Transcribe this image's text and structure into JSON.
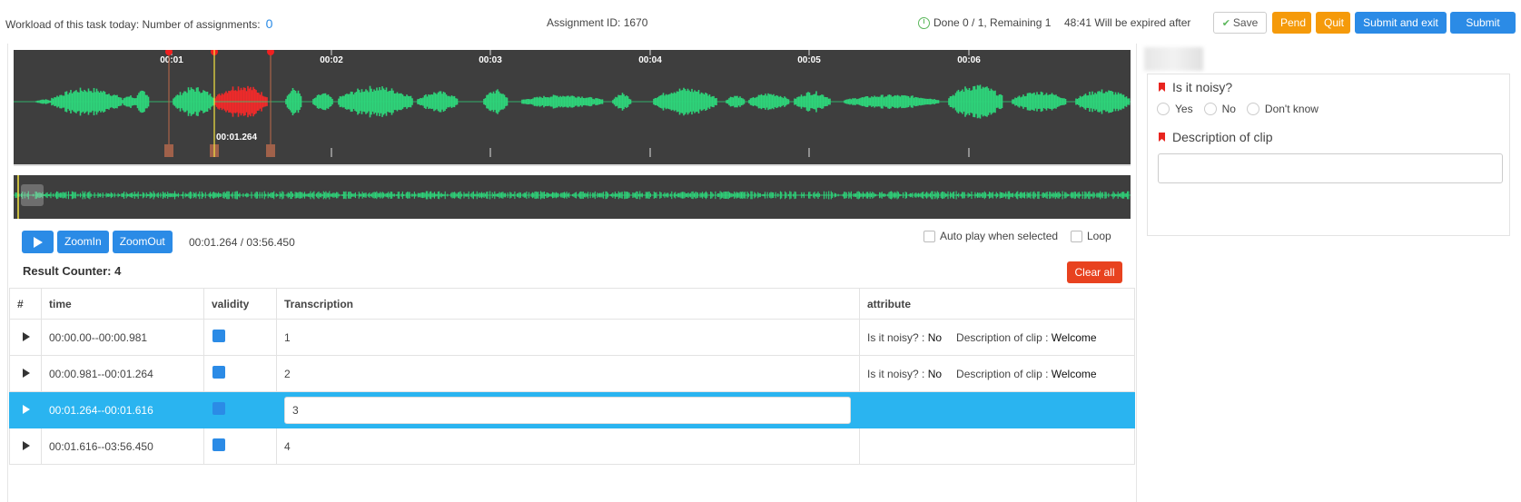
{
  "header": {
    "workload_label": "Workload of this task today: Number of assignments:",
    "workload_count": "0",
    "assignment_id": "Assignment ID: 1670",
    "done_text": "Done 0 / 1, Remaining 1",
    "expire_text": "48:41 Will be expired after",
    "buttons": {
      "save": "Save",
      "pend": "Pend",
      "quit": "Quit",
      "submit_exit": "Submit and exit",
      "submit": "Submit (D)"
    },
    "colors": {
      "primary": "#2b8be6",
      "warning": "#f59a0a",
      "danger": "#e8421f"
    }
  },
  "waveform": {
    "ticks": [
      "00:01",
      "00:02",
      "00:03",
      "00:04",
      "00:05",
      "00:06"
    ],
    "cursor_label": "00:01.264",
    "wave_color": "#2ed47a",
    "selected_color": "#f02a2a"
  },
  "controls": {
    "zoom_in": "ZoomIn",
    "zoom_out": "ZoomOut",
    "time": "00:01.264 / 03:56.450",
    "autoplay_label": "Auto play when selected",
    "loop_label": "Loop"
  },
  "results": {
    "counter": "Result Counter: 4",
    "clear_all": "Clear all",
    "columns": [
      "#",
      "time",
      "validity",
      "Transcription",
      "attribute"
    ],
    "rows": [
      {
        "time": "00:00.00--00:00.981",
        "transcription": "1",
        "attr_q1": "Is it noisy? :",
        "attr_v1": "No",
        "attr_q2": "Description of clip :",
        "attr_v2": "Welcome"
      },
      {
        "time": "00:00.981--00:01.264",
        "transcription": "2",
        "attr_q1": "Is it noisy? :",
        "attr_v1": "No",
        "attr_q2": "Description of clip :",
        "attr_v2": "Welcome"
      },
      {
        "time": "00:01.264--00:01.616",
        "transcription": "3",
        "selected": true
      },
      {
        "time": "00:01.616--03:56.450",
        "transcription": "4"
      }
    ]
  },
  "form": {
    "q1_label": "Is it noisy?",
    "q1_options": [
      "Yes",
      "No",
      "Don't know"
    ],
    "q2_label": "Description of clip"
  }
}
